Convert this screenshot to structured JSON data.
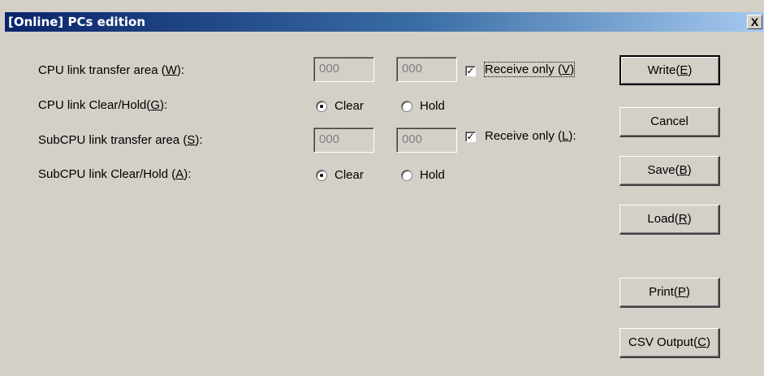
{
  "window": {
    "title": "[Online] PCs edition",
    "close_glyph": "X"
  },
  "rows": {
    "cpu_transfer": {
      "label_pre": "CPU link transfer area (",
      "label_key": "W",
      "label_post": "):",
      "field1": "000",
      "field2": "000",
      "receive_pre": "Receive only (",
      "receive_key": "V",
      "receive_post": ")",
      "receive_checked": true
    },
    "cpu_clearhold": {
      "label_pre": "CPU link Clear/Hold(",
      "label_key": "G",
      "label_post": "):",
      "opt_clear": "Clear",
      "opt_hold": "Hold",
      "selected": "Clear"
    },
    "sub_transfer": {
      "label_pre": "SubCPU link transfer area (",
      "label_key": "S",
      "label_post": "):",
      "field1": "000",
      "field2": "000",
      "receive_pre": "Receive only (",
      "receive_key": "L",
      "receive_post": "):",
      "receive_checked": true
    },
    "sub_clearhold": {
      "label_pre": "SubCPU link Clear/Hold (",
      "label_key": "A",
      "label_post": "):",
      "opt_clear": "Clear",
      "opt_hold": "Hold",
      "selected": "Clear"
    }
  },
  "buttons": {
    "write": {
      "pre": "Write(",
      "key": "E",
      "post": ")"
    },
    "cancel": {
      "label": "Cancel"
    },
    "save": {
      "pre": "Save(",
      "key": "B",
      "post": ")"
    },
    "load": {
      "pre": "Load(",
      "key": "R",
      "post": ")"
    },
    "print": {
      "pre": "Print(",
      "key": "P",
      "post": ")"
    },
    "csv": {
      "pre": "CSV Output(",
      "key": "C",
      "post": ")"
    }
  },
  "colors": {
    "dialog_bg": "#d4d0c8",
    "title_start": "#0a246a",
    "title_end": "#a6caf0"
  }
}
